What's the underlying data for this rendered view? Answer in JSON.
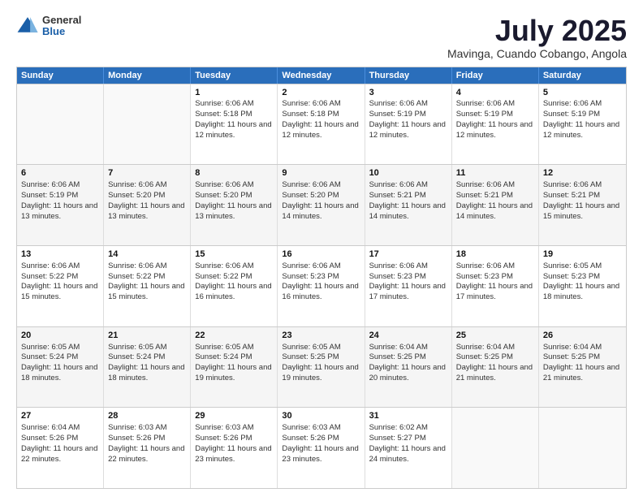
{
  "header": {
    "logo_general": "General",
    "logo_blue": "Blue",
    "month_title": "July 2025",
    "location": "Mavinga, Cuando Cobango, Angola"
  },
  "days_of_week": [
    "Sunday",
    "Monday",
    "Tuesday",
    "Wednesday",
    "Thursday",
    "Friday",
    "Saturday"
  ],
  "weeks": [
    [
      {
        "day": "",
        "sunrise": "",
        "sunset": "",
        "daylight": "",
        "empty": true
      },
      {
        "day": "",
        "sunrise": "",
        "sunset": "",
        "daylight": "",
        "empty": true
      },
      {
        "day": "1",
        "sunrise": "Sunrise: 6:06 AM",
        "sunset": "Sunset: 5:18 PM",
        "daylight": "Daylight: 11 hours and 12 minutes.",
        "empty": false
      },
      {
        "day": "2",
        "sunrise": "Sunrise: 6:06 AM",
        "sunset": "Sunset: 5:18 PM",
        "daylight": "Daylight: 11 hours and 12 minutes.",
        "empty": false
      },
      {
        "day": "3",
        "sunrise": "Sunrise: 6:06 AM",
        "sunset": "Sunset: 5:19 PM",
        "daylight": "Daylight: 11 hours and 12 minutes.",
        "empty": false
      },
      {
        "day": "4",
        "sunrise": "Sunrise: 6:06 AM",
        "sunset": "Sunset: 5:19 PM",
        "daylight": "Daylight: 11 hours and 12 minutes.",
        "empty": false
      },
      {
        "day": "5",
        "sunrise": "Sunrise: 6:06 AM",
        "sunset": "Sunset: 5:19 PM",
        "daylight": "Daylight: 11 hours and 12 minutes.",
        "empty": false
      }
    ],
    [
      {
        "day": "6",
        "sunrise": "Sunrise: 6:06 AM",
        "sunset": "Sunset: 5:19 PM",
        "daylight": "Daylight: 11 hours and 13 minutes.",
        "empty": false
      },
      {
        "day": "7",
        "sunrise": "Sunrise: 6:06 AM",
        "sunset": "Sunset: 5:20 PM",
        "daylight": "Daylight: 11 hours and 13 minutes.",
        "empty": false
      },
      {
        "day": "8",
        "sunrise": "Sunrise: 6:06 AM",
        "sunset": "Sunset: 5:20 PM",
        "daylight": "Daylight: 11 hours and 13 minutes.",
        "empty": false
      },
      {
        "day": "9",
        "sunrise": "Sunrise: 6:06 AM",
        "sunset": "Sunset: 5:20 PM",
        "daylight": "Daylight: 11 hours and 14 minutes.",
        "empty": false
      },
      {
        "day": "10",
        "sunrise": "Sunrise: 6:06 AM",
        "sunset": "Sunset: 5:21 PM",
        "daylight": "Daylight: 11 hours and 14 minutes.",
        "empty": false
      },
      {
        "day": "11",
        "sunrise": "Sunrise: 6:06 AM",
        "sunset": "Sunset: 5:21 PM",
        "daylight": "Daylight: 11 hours and 14 minutes.",
        "empty": false
      },
      {
        "day": "12",
        "sunrise": "Sunrise: 6:06 AM",
        "sunset": "Sunset: 5:21 PM",
        "daylight": "Daylight: 11 hours and 15 minutes.",
        "empty": false
      }
    ],
    [
      {
        "day": "13",
        "sunrise": "Sunrise: 6:06 AM",
        "sunset": "Sunset: 5:22 PM",
        "daylight": "Daylight: 11 hours and 15 minutes.",
        "empty": false
      },
      {
        "day": "14",
        "sunrise": "Sunrise: 6:06 AM",
        "sunset": "Sunset: 5:22 PM",
        "daylight": "Daylight: 11 hours and 15 minutes.",
        "empty": false
      },
      {
        "day": "15",
        "sunrise": "Sunrise: 6:06 AM",
        "sunset": "Sunset: 5:22 PM",
        "daylight": "Daylight: 11 hours and 16 minutes.",
        "empty": false
      },
      {
        "day": "16",
        "sunrise": "Sunrise: 6:06 AM",
        "sunset": "Sunset: 5:23 PM",
        "daylight": "Daylight: 11 hours and 16 minutes.",
        "empty": false
      },
      {
        "day": "17",
        "sunrise": "Sunrise: 6:06 AM",
        "sunset": "Sunset: 5:23 PM",
        "daylight": "Daylight: 11 hours and 17 minutes.",
        "empty": false
      },
      {
        "day": "18",
        "sunrise": "Sunrise: 6:06 AM",
        "sunset": "Sunset: 5:23 PM",
        "daylight": "Daylight: 11 hours and 17 minutes.",
        "empty": false
      },
      {
        "day": "19",
        "sunrise": "Sunrise: 6:05 AM",
        "sunset": "Sunset: 5:23 PM",
        "daylight": "Daylight: 11 hours and 18 minutes.",
        "empty": false
      }
    ],
    [
      {
        "day": "20",
        "sunrise": "Sunrise: 6:05 AM",
        "sunset": "Sunset: 5:24 PM",
        "daylight": "Daylight: 11 hours and 18 minutes.",
        "empty": false
      },
      {
        "day": "21",
        "sunrise": "Sunrise: 6:05 AM",
        "sunset": "Sunset: 5:24 PM",
        "daylight": "Daylight: 11 hours and 18 minutes.",
        "empty": false
      },
      {
        "day": "22",
        "sunrise": "Sunrise: 6:05 AM",
        "sunset": "Sunset: 5:24 PM",
        "daylight": "Daylight: 11 hours and 19 minutes.",
        "empty": false
      },
      {
        "day": "23",
        "sunrise": "Sunrise: 6:05 AM",
        "sunset": "Sunset: 5:25 PM",
        "daylight": "Daylight: 11 hours and 19 minutes.",
        "empty": false
      },
      {
        "day": "24",
        "sunrise": "Sunrise: 6:04 AM",
        "sunset": "Sunset: 5:25 PM",
        "daylight": "Daylight: 11 hours and 20 minutes.",
        "empty": false
      },
      {
        "day": "25",
        "sunrise": "Sunrise: 6:04 AM",
        "sunset": "Sunset: 5:25 PM",
        "daylight": "Daylight: 11 hours and 21 minutes.",
        "empty": false
      },
      {
        "day": "26",
        "sunrise": "Sunrise: 6:04 AM",
        "sunset": "Sunset: 5:25 PM",
        "daylight": "Daylight: 11 hours and 21 minutes.",
        "empty": false
      }
    ],
    [
      {
        "day": "27",
        "sunrise": "Sunrise: 6:04 AM",
        "sunset": "Sunset: 5:26 PM",
        "daylight": "Daylight: 11 hours and 22 minutes.",
        "empty": false
      },
      {
        "day": "28",
        "sunrise": "Sunrise: 6:03 AM",
        "sunset": "Sunset: 5:26 PM",
        "daylight": "Daylight: 11 hours and 22 minutes.",
        "empty": false
      },
      {
        "day": "29",
        "sunrise": "Sunrise: 6:03 AM",
        "sunset": "Sunset: 5:26 PM",
        "daylight": "Daylight: 11 hours and 23 minutes.",
        "empty": false
      },
      {
        "day": "30",
        "sunrise": "Sunrise: 6:03 AM",
        "sunset": "Sunset: 5:26 PM",
        "daylight": "Daylight: 11 hours and 23 minutes.",
        "empty": false
      },
      {
        "day": "31",
        "sunrise": "Sunrise: 6:02 AM",
        "sunset": "Sunset: 5:27 PM",
        "daylight": "Daylight: 11 hours and 24 minutes.",
        "empty": false
      },
      {
        "day": "",
        "sunrise": "",
        "sunset": "",
        "daylight": "",
        "empty": true
      },
      {
        "day": "",
        "sunrise": "",
        "sunset": "",
        "daylight": "",
        "empty": true
      }
    ]
  ]
}
